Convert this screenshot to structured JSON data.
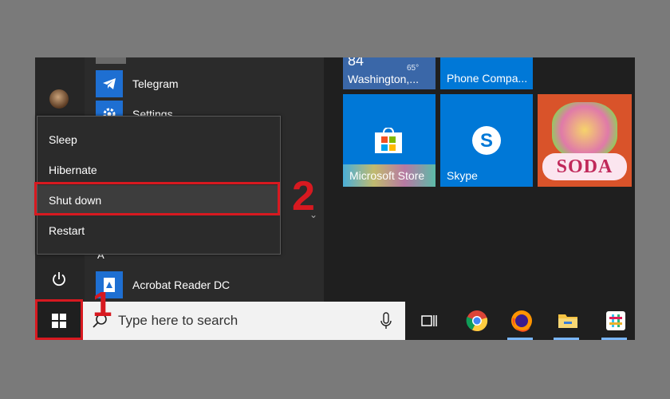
{
  "start_menu": {
    "apps": [
      {
        "label": "Telegram",
        "icon": "telegram-icon"
      },
      {
        "label": "Settings",
        "icon": "gear-icon"
      },
      {
        "label": "Acrobat Reader DC",
        "icon": "acrobat-icon"
      }
    ],
    "section_letter": "A",
    "power_menu": {
      "items": [
        "Sleep",
        "Hibernate",
        "Shut down",
        "Restart"
      ]
    }
  },
  "tiles": {
    "weather": {
      "temp": "84",
      "temp_small": "65°",
      "unit": "°",
      "city": "Washington,..."
    },
    "phone": {
      "label": "Phone Compa..."
    },
    "store": {
      "label": "Microsoft Store"
    },
    "skype": {
      "label": "Skype"
    },
    "candy": {
      "label": "SODA"
    }
  },
  "taskbar": {
    "search_placeholder": "Type here to search",
    "icons": [
      "task-view-icon",
      "chrome-icon",
      "firefox-icon",
      "file-explorer-icon",
      "slack-icon"
    ]
  },
  "callouts": {
    "one": "1",
    "two": "2"
  },
  "colors": {
    "highlight": "#d71920",
    "tile_blue": "#0078d7",
    "menu_bg": "#2b2b2b"
  }
}
